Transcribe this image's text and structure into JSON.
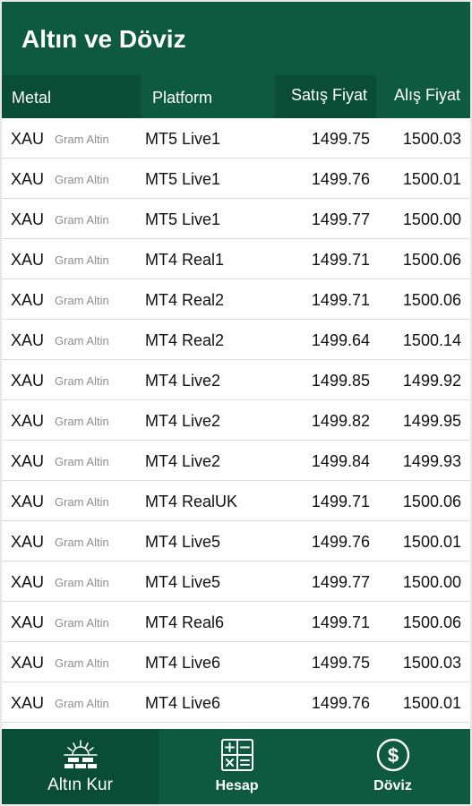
{
  "appbar": {
    "title": "Altın ve Döviz"
  },
  "table": {
    "headers": {
      "metal": "Metal",
      "platform": "Platform",
      "sell": "Satış Fiyat",
      "buy": "Alış Fiyat"
    },
    "rows": [
      {
        "code": "XAU",
        "sub": "Gram Altin",
        "platform": "MT5 Live1",
        "sell": "1499.75",
        "buy": "1500.03"
      },
      {
        "code": "XAU",
        "sub": "Gram Altin",
        "platform": "MT5 Live1",
        "sell": "1499.76",
        "buy": "1500.01"
      },
      {
        "code": "XAU",
        "sub": "Gram Altin",
        "platform": "MT5 Live1",
        "sell": "1499.77",
        "buy": "1500.00"
      },
      {
        "code": "XAU",
        "sub": "Gram Altin",
        "platform": "MT4 Real1",
        "sell": "1499.71",
        "buy": "1500.06"
      },
      {
        "code": "XAU",
        "sub": "Gram Altin",
        "platform": "MT4 Real2",
        "sell": "1499.71",
        "buy": "1500.06"
      },
      {
        "code": "XAU",
        "sub": "Gram Altin",
        "platform": "MT4 Real2",
        "sell": "1499.64",
        "buy": "1500.14"
      },
      {
        "code": "XAU",
        "sub": "Gram Altin",
        "platform": "MT4 Live2",
        "sell": "1499.85",
        "buy": "1499.92"
      },
      {
        "code": "XAU",
        "sub": "Gram Altin",
        "platform": "MT4 Live2",
        "sell": "1499.82",
        "buy": "1499.95"
      },
      {
        "code": "XAU",
        "sub": "Gram Altin",
        "platform": "MT4 Live2",
        "sell": "1499.84",
        "buy": "1499.93"
      },
      {
        "code": "XAU",
        "sub": "Gram Altin",
        "platform": "MT4 RealUK",
        "sell": "1499.71",
        "buy": "1500.06"
      },
      {
        "code": "XAU",
        "sub": "Gram Altin",
        "platform": "MT4 Live5",
        "sell": "1499.76",
        "buy": "1500.01"
      },
      {
        "code": "XAU",
        "sub": "Gram Altin",
        "platform": "MT4 Live5",
        "sell": "1499.77",
        "buy": "1500.00"
      },
      {
        "code": "XAU",
        "sub": "Gram Altin",
        "platform": "MT4 Real6",
        "sell": "1499.71",
        "buy": "1500.06"
      },
      {
        "code": "XAU",
        "sub": "Gram Altin",
        "platform": "MT4 Live6",
        "sell": "1499.75",
        "buy": "1500.03"
      },
      {
        "code": "XAU",
        "sub": "Gram Altin",
        "platform": "MT4 Live6",
        "sell": "1499.76",
        "buy": "1500.01"
      }
    ]
  },
  "nav": {
    "items": [
      {
        "label": "Altın Kur",
        "icon": "gold-bars-sunrise-icon",
        "active": true
      },
      {
        "label": "Hesap",
        "icon": "calculator-icon",
        "active": false
      },
      {
        "label": "Döviz",
        "icon": "dollar-coin-icon",
        "active": false
      }
    ]
  },
  "colors": {
    "primary": "#0d5a41",
    "primary_dark": "#0a4d36",
    "row_border": "#dcdcdc",
    "subtext": "#8e8e8e"
  }
}
